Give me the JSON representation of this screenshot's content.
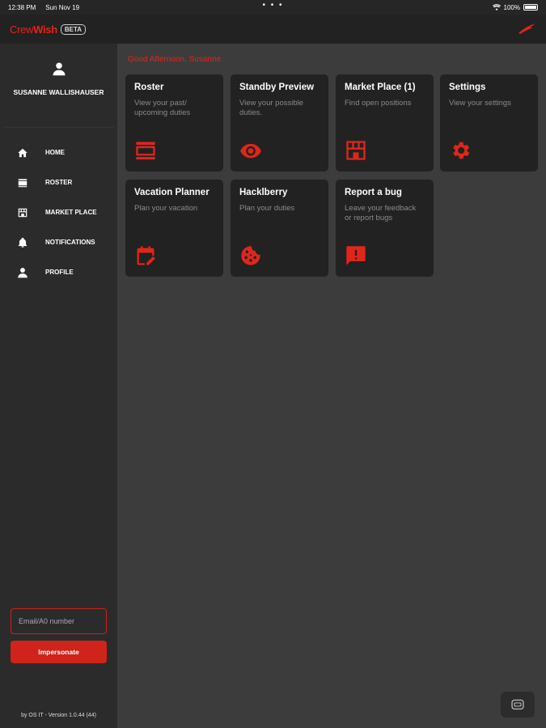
{
  "status_bar": {
    "time": "12:38 PM",
    "date": "Sun Nov 19",
    "dots": "• • •",
    "battery": "100%"
  },
  "app": {
    "logo_crew": "Crew",
    "logo_wish": "Wish",
    "badge": "BETA"
  },
  "profile": {
    "name": "SUSANNE WALLISHAUSER"
  },
  "nav": [
    {
      "label": "HOME",
      "icon": "home-icon"
    },
    {
      "label": "ROSTER",
      "icon": "roster-icon"
    },
    {
      "label": "MARKET PLACE",
      "icon": "store-icon"
    },
    {
      "label": "NOTIFICATIONS",
      "icon": "bell-icon"
    },
    {
      "label": "PROFILE",
      "icon": "person-icon"
    }
  ],
  "impersonate": {
    "placeholder": "Email/A0 number",
    "button": "Impersonate"
  },
  "version": "by OS IT - Version 1.0.44 (44)",
  "greeting": "Good Afternoon, Susanne",
  "tiles": [
    {
      "title": "Roster",
      "desc": "View your past/ upcoming duties",
      "icon": "roster-icon"
    },
    {
      "title": "Standby Preview",
      "desc": "View your possible duties.",
      "icon": "eye-icon"
    },
    {
      "title": "Market Place (1)",
      "desc": "Find open positions",
      "icon": "store-icon"
    },
    {
      "title": "Settings",
      "desc": "View your settings",
      "icon": "gear-icon"
    },
    {
      "title": "Vacation Planner",
      "desc": "Plan your vacation",
      "icon": "calendar-edit-icon"
    },
    {
      "title": "Hacklberry",
      "desc": "Plan your duties",
      "icon": "cookie-icon"
    },
    {
      "title": "Report a bug",
      "desc": "Leave your feedback or report bugs",
      "icon": "feedback-icon"
    }
  ],
  "colors": {
    "accent": "#e0261b",
    "background": "#3c3c3c",
    "sidebar": "#2b2b2b",
    "tile": "#222222"
  }
}
